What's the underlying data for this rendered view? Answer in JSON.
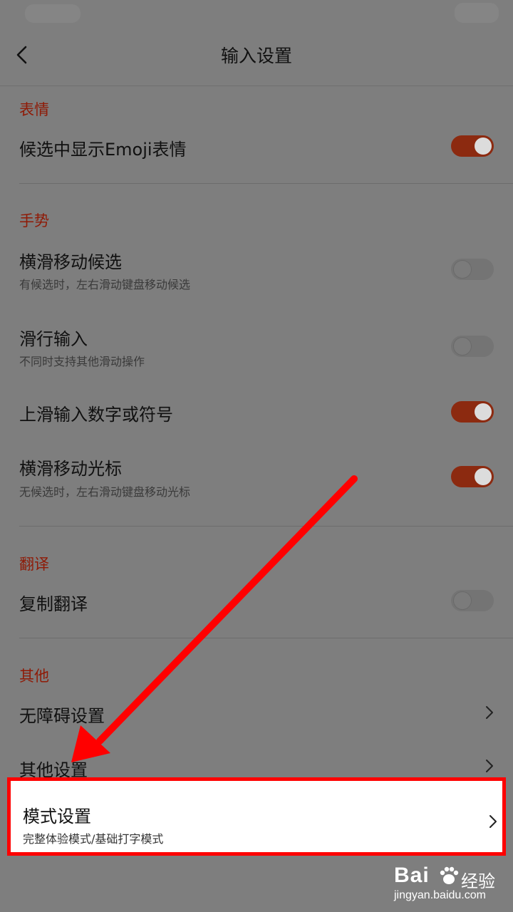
{
  "header": {
    "title": "输入设置"
  },
  "sections": [
    {
      "title": "表情",
      "items": [
        {
          "label": "候选中显示Emoji表情",
          "toggle": "on"
        }
      ]
    },
    {
      "title": "手势",
      "items": [
        {
          "label": "横滑移动候选",
          "sub": "有候选时，左右滑动键盘移动候选",
          "toggle": "off"
        },
        {
          "label": "滑行输入",
          "sub": "不同时支持其他滑动操作",
          "toggle": "off"
        },
        {
          "label": "上滑输入数字或符号",
          "toggle": "on"
        },
        {
          "label": "横滑移动光标",
          "sub": "无候选时，左右滑动键盘移动光标",
          "toggle": "on"
        }
      ]
    },
    {
      "title": "翻译",
      "items": [
        {
          "label": "复制翻译",
          "toggle": "off"
        }
      ]
    },
    {
      "title": "其他",
      "items": [
        {
          "label": "无障碍设置"
        },
        {
          "label": "其他设置"
        },
        {
          "label": "模式设置",
          "sub": "完整体验模式/基础打字模式",
          "highlighted": true
        }
      ]
    }
  ],
  "watermark": {
    "brand_cn": "经验",
    "url": "jingyan.baidu.com"
  },
  "colors": {
    "accent": "#8c2a10",
    "section_title": "#8f1a06",
    "annotation": "#ff0000"
  },
  "icons": [
    "back-arrow-icon",
    "chevron-right-icon",
    "annotation-arrow-icon",
    "baidu-paw-icon"
  ]
}
